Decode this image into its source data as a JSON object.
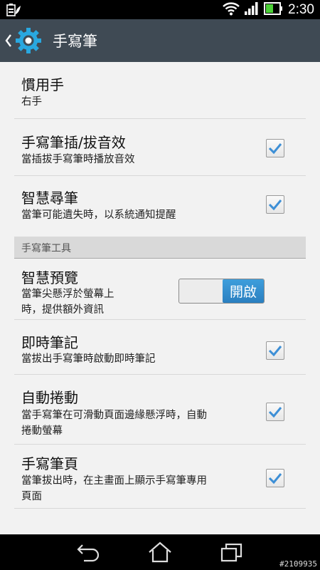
{
  "status_bar": {
    "time": "2:30",
    "icons": [
      "battery-saver-icon",
      "wifi-icon",
      "cell-signal-icon",
      "battery-icon"
    ]
  },
  "action_bar": {
    "title": "手寫筆",
    "app_icon": "gear-icon",
    "back_icon": "chevron-left-icon"
  },
  "preferences": [
    {
      "title": "慣用手",
      "summary": "右手",
      "control": "none"
    },
    {
      "title": "手寫筆插/拔音效",
      "summary": "當插拔手寫筆時播放音效",
      "control": "checkbox",
      "checked": true
    },
    {
      "title": "智慧尋筆",
      "summary": "當筆可能遺失時，以系統通知提醒",
      "control": "checkbox",
      "checked": true
    }
  ],
  "category": {
    "label": "手寫筆工具"
  },
  "tool_preferences": [
    {
      "title": "智慧預覽",
      "summary": "當筆尖懸浮於螢幕上時，提供額外資訊",
      "summary_lines": [
        "當筆尖懸浮於螢幕上",
        "時，提供額外資訊"
      ],
      "control": "switch",
      "switch_label": "開啟",
      "on": true
    },
    {
      "title": "即時筆記",
      "summary": "當拔出手寫筆時啟動即時筆記",
      "control": "checkbox",
      "checked": true
    },
    {
      "title": "自動捲動",
      "summary": "當手寫筆在可滑動頁面邊緣懸浮時，自動捲動螢幕",
      "summary_lines": [
        "當手寫筆在可滑動頁面邊緣懸浮時，自動",
        "捲動螢幕"
      ],
      "control": "checkbox",
      "checked": true
    },
    {
      "title": "手寫筆頁",
      "summary": "當筆拔出時，在主畫面上顯示手寫筆專用頁面",
      "summary_lines": [
        "當筆拔出時，在主畫面上顯示手寫筆專用",
        "頁面"
      ],
      "control": "checkbox",
      "checked": true
    }
  ],
  "nav_bar": {
    "buttons": [
      "back-icon",
      "home-icon",
      "recent-apps-icon"
    ],
    "identifier": "#2109935"
  },
  "colors": {
    "action_bar": "#3f4a54",
    "background": "#f2f2f2",
    "category_bg": "#d9d9d9",
    "switch_on": "#2a7fc0",
    "check": "#3d8fd6"
  }
}
